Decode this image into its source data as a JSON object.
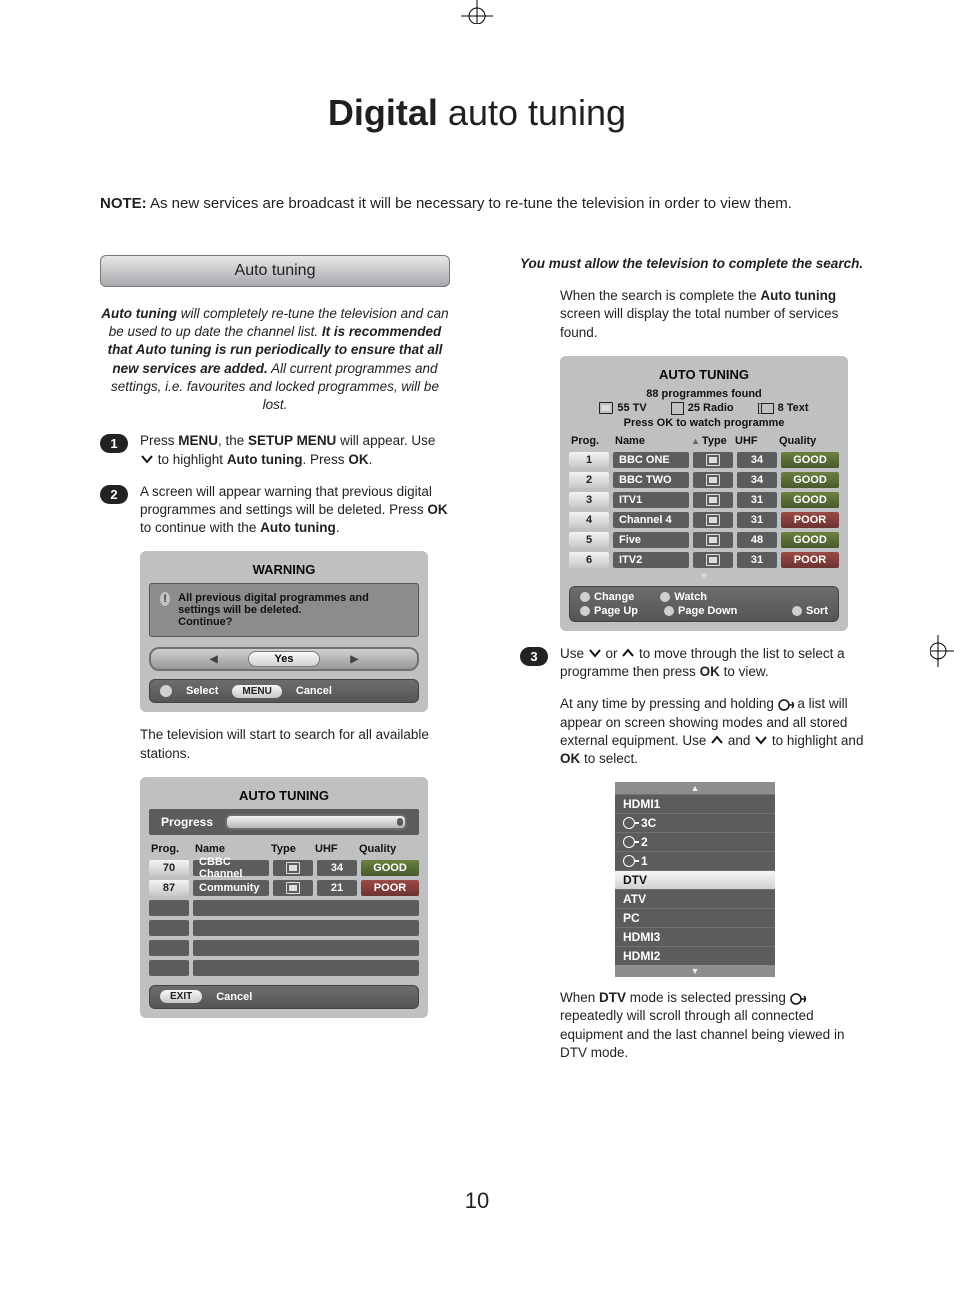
{
  "title": {
    "bold": "Digital",
    "light": " auto tuning"
  },
  "note": {
    "prefix": "NOTE:",
    "body": " As new services are broadcast it will be necessary to re-tune the television in order to view them."
  },
  "header": "Auto tuning",
  "intro": {
    "p1_a": "Auto tuning",
    "p1_b": " will completely re-tune the television and can be used to up date the channel list. ",
    "p1_c": "It is recommended that Auto tuning is run periodically to ensure that all new services are added.",
    "p1_d": " All current programmes and settings, i.e. favourites and locked programmes, will be lost."
  },
  "steps": {
    "s1_num": "1",
    "s1": {
      "a": "Press ",
      "b": "MENU",
      "c": ", the ",
      "d": "SETUP MENU",
      "e": " will appear. Use ",
      "f": " to highlight ",
      "g": "Auto tuning",
      "h": ". Press ",
      "i": "OK",
      "j": "."
    },
    "s2_num": "2",
    "s2": {
      "a": "A screen will appear warning that previous digital programmes and settings will be deleted. Press ",
      "b": "OK",
      "c": " to continue with the ",
      "d": "Auto tuning",
      "e": "."
    },
    "s3_num": "3",
    "s3": {
      "a": "Use ",
      "b": " or ",
      "c": " to move through the list to select a programme then press ",
      "d": "OK",
      "e": " to view."
    }
  },
  "warning": {
    "title": "WARNING",
    "body": "All previous digital programmes and settings will be deleted.\nContinue?",
    "yes": "Yes",
    "select": "Select",
    "menu": "MENU",
    "cancel": "Cancel"
  },
  "after_warn": "The television will start to search for all available stations.",
  "scan": {
    "title": "AUTO TUNING",
    "progress": "Progress",
    "head": {
      "prog": "Prog.",
      "name": "Name",
      "type": "Type",
      "uhf": "UHF",
      "quality": "Quality"
    },
    "rows": [
      {
        "prog": "70",
        "name": "CBBC Channel",
        "uhf": "34",
        "q": "GOOD",
        "qc": "good"
      },
      {
        "prog": "87",
        "name": "Community",
        "uhf": "21",
        "q": "POOR",
        "qc": "poor"
      }
    ],
    "exit": "EXIT",
    "cancel": "Cancel"
  },
  "right": {
    "must": "You must allow the television to complete the search.",
    "done_a": "When the search is complete the ",
    "done_b": "Auto tuning",
    "done_c": " screen will display the total number of services found."
  },
  "results": {
    "title": "AUTO TUNING",
    "found": "88 programmes found",
    "line_tv": "55  TV",
    "line_radio": "25  Radio",
    "line_text": "8   Text",
    "press": "Press OK to watch programme",
    "head": {
      "prog": "Prog.",
      "name": "Name",
      "type": "Type",
      "uhf": "UHF",
      "quality": "Quality"
    },
    "rows": [
      {
        "prog": "1",
        "name": "BBC ONE",
        "uhf": "34",
        "q": "GOOD",
        "qc": "good"
      },
      {
        "prog": "2",
        "name": "BBC TWO",
        "uhf": "34",
        "q": "GOOD",
        "qc": "good"
      },
      {
        "prog": "3",
        "name": "ITV1",
        "uhf": "31",
        "q": "GOOD",
        "qc": "good"
      },
      {
        "prog": "4",
        "name": "Channel 4",
        "uhf": "31",
        "q": "POOR",
        "qc": "poor"
      },
      {
        "prog": "5",
        "name": "Five",
        "uhf": "48",
        "q": "GOOD",
        "qc": "good"
      },
      {
        "prog": "6",
        "name": "ITV2",
        "uhf": "31",
        "q": "POOR",
        "qc": "poor"
      }
    ],
    "change": "Change",
    "watch": "Watch",
    "pgup": "Page Up",
    "pgdn": "Page Down",
    "sort": "Sort"
  },
  "any": {
    "a": "At any time by pressing and holding ",
    "b": " a list will appear on screen showing modes and all stored external equipment. Use ",
    "c": " and ",
    "d": " to highlight and ",
    "e": "OK",
    "f": " to select."
  },
  "inputs": [
    "HDMI1",
    "3C",
    "2",
    "1",
    "DTV",
    "ATV",
    "PC",
    "HDMI3",
    "HDMI2"
  ],
  "dtv": {
    "a": "When ",
    "b": "DTV",
    "c": " mode is selected pressing ",
    "d": " repeatedly will scroll through all connected equipment and the last channel being viewed in DTV mode."
  },
  "page_num": "10"
}
